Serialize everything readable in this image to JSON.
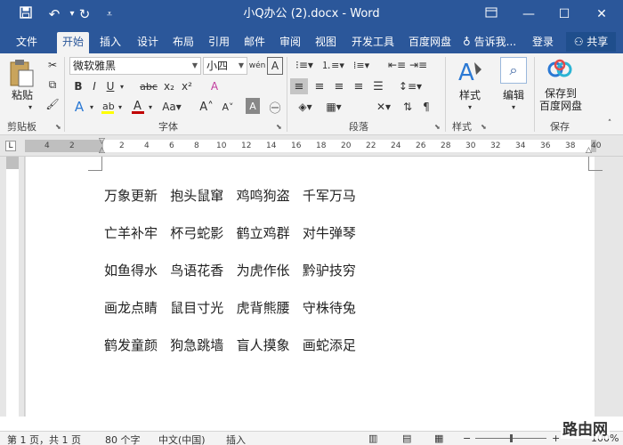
{
  "titlebar": {
    "title": "小Q办公 (2).docx - Word",
    "save_icon": "save-icon",
    "undo_icon": "undo-icon",
    "redo_icon": "redo-icon",
    "customize_icon": "customize-qat-icon"
  },
  "menu": {
    "tabs": [
      "文件",
      "开始",
      "插入",
      "设计",
      "布局",
      "引用",
      "邮件",
      "审阅",
      "视图",
      "开发工具",
      "百度网盘"
    ],
    "active": "开始",
    "tell_me": "告诉我...",
    "sign_in": "登录",
    "share": "共享"
  },
  "ribbon": {
    "clipboard": {
      "paste": "粘贴",
      "label": "剪贴板"
    },
    "font": {
      "name": "微软雅黑",
      "size": "小四",
      "label": "字体",
      "bold": "B",
      "italic": "I",
      "underline": "U",
      "strike": "abc",
      "subscript": "x₂",
      "superscript": "x²",
      "font_color_accent": "#c00000",
      "highlight_accent": "#ffff00"
    },
    "paragraph": {
      "label": "段落"
    },
    "styles": {
      "button": "样式",
      "label": "样式"
    },
    "editing": {
      "button": "编辑"
    },
    "save": {
      "button_line1": "保存到",
      "button_line2": "百度网盘",
      "label": "保存"
    }
  },
  "ruler": {
    "ticks": [
      "4",
      "2",
      "",
      "2",
      "4",
      "6",
      "8",
      "10",
      "12",
      "14",
      "16",
      "18",
      "20",
      "22",
      "24",
      "26",
      "28",
      "30",
      "32",
      "34",
      "36",
      "38",
      "",
      "40"
    ],
    "corner": "L"
  },
  "document": {
    "lines": [
      "万象更新   抱头鼠窜   鸡鸣狗盗   千军万马",
      "亡羊补牢   杯弓蛇影   鹤立鸡群   对牛弹琴",
      "如鱼得水   鸟语花香   为虎作伥   黔驴技穷",
      "画龙点睛   鼠目寸光   虎背熊腰   守株待兔",
      "鹤发童颜   狗急跳墙   盲人摸象   画蛇添足"
    ]
  },
  "status": {
    "page": "第 1 页，共 1 页",
    "words": "80 个字",
    "language": "中文(中国)",
    "mode": "插入",
    "zoom": "100%"
  },
  "watermark": "路由网",
  "colors": {
    "brand": "#2b579a"
  }
}
